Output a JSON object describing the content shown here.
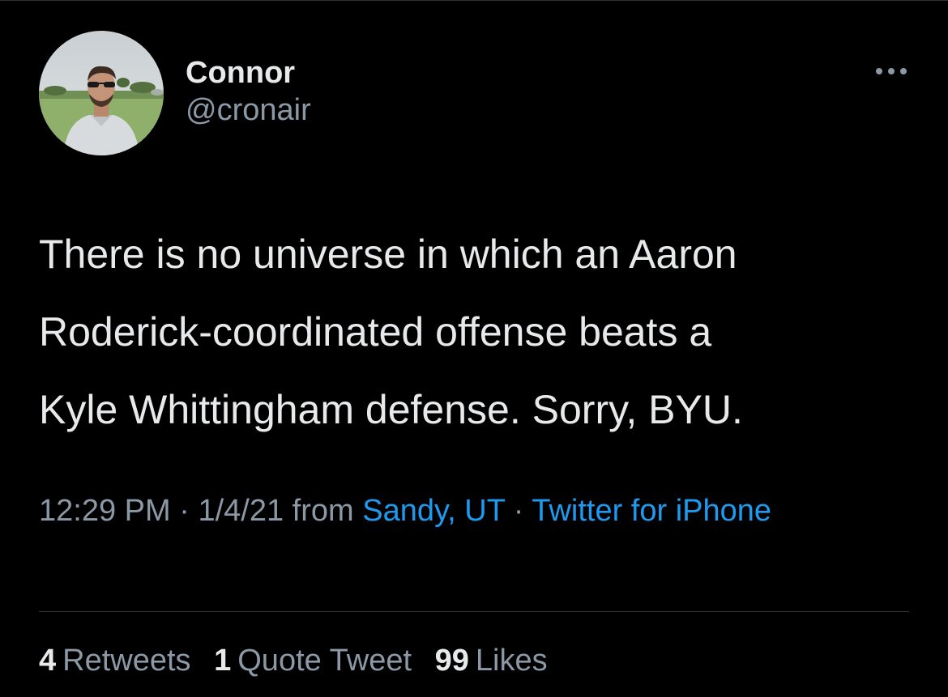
{
  "user": {
    "display_name": "Connor",
    "handle": "@cronair"
  },
  "tweet": {
    "text": "There is no universe in which an Aaron\nRoderick-coordinated offense beats a\nKyle Whittingham defense. Sorry, BYU."
  },
  "meta": {
    "time": "12:29 PM",
    "separator": " · ",
    "date": "1/4/21",
    "from_label": " from ",
    "location": "Sandy, UT",
    "source": "Twitter for iPhone"
  },
  "stats": {
    "retweets_count": "4",
    "retweets_label": "Retweets",
    "quotes_count": "1",
    "quotes_label": "Quote Tweet",
    "likes_count": "99",
    "likes_label": "Likes"
  },
  "icons": {
    "more": "more-horizontal-icon",
    "avatar": "profile-photo"
  },
  "colors": {
    "background": "#000000",
    "text_primary": "#e7e9ea",
    "text_secondary": "#8b98a5",
    "link": "#1d9bf0",
    "divider": "#2f3336"
  }
}
